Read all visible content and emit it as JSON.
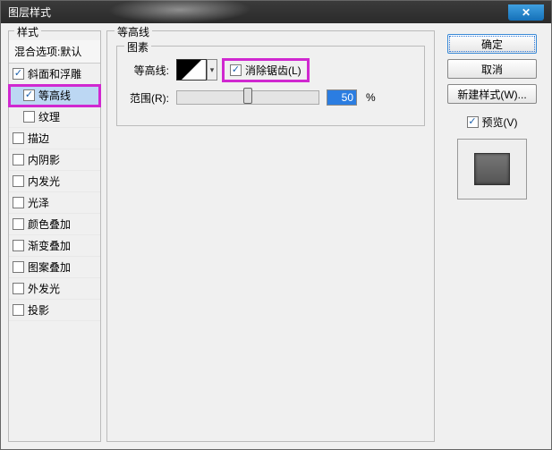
{
  "window": {
    "title": "图层样式"
  },
  "styles_panel": {
    "label": "样式",
    "blend_header": "混合选项:默认",
    "items": [
      {
        "label": "斜面和浮雕",
        "checked": true,
        "indent": false
      },
      {
        "label": "等高线",
        "checked": true,
        "indent": true,
        "selected": true,
        "highlight": true
      },
      {
        "label": "纹理",
        "checked": false,
        "indent": true
      },
      {
        "label": "描边",
        "checked": false,
        "indent": false
      },
      {
        "label": "内阴影",
        "checked": false,
        "indent": false
      },
      {
        "label": "内发光",
        "checked": false,
        "indent": false
      },
      {
        "label": "光泽",
        "checked": false,
        "indent": false
      },
      {
        "label": "颜色叠加",
        "checked": false,
        "indent": false
      },
      {
        "label": "渐变叠加",
        "checked": false,
        "indent": false
      },
      {
        "label": "图案叠加",
        "checked": false,
        "indent": false
      },
      {
        "label": "外发光",
        "checked": false,
        "indent": false
      },
      {
        "label": "投影",
        "checked": false,
        "indent": false
      }
    ]
  },
  "center": {
    "outer_label": "等高线",
    "elements_label": "图素",
    "contour_label": "等高线:",
    "antialias": {
      "label": "消除锯齿(L)",
      "checked": true
    },
    "range": {
      "label": "范围(R):",
      "value": "50",
      "unit": "%",
      "percent": 50
    }
  },
  "right": {
    "ok": "确定",
    "cancel": "取消",
    "new_style": "新建样式(W)...",
    "preview_label": "预览(V)",
    "preview_checked": true
  }
}
